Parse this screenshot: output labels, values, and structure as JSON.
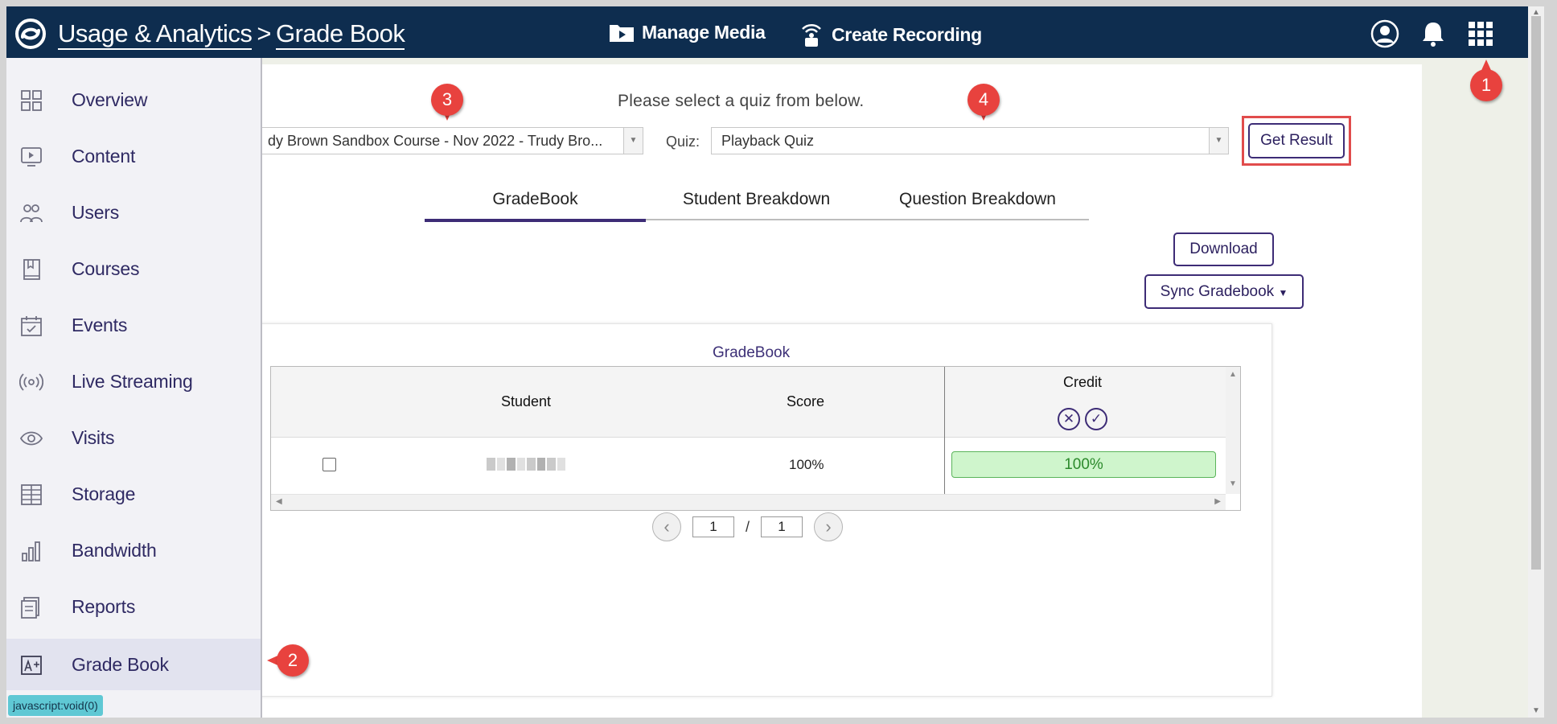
{
  "header": {
    "breadcrumb_parent": "Usage & Analytics",
    "breadcrumb_sep": ">",
    "breadcrumb_current": "Grade Book",
    "manage_media": "Manage Media",
    "create_recording": "Create Recording"
  },
  "sidebar": {
    "items": [
      {
        "label": "Overview",
        "icon": "grid-icon"
      },
      {
        "label": "Content",
        "icon": "play-screen-icon"
      },
      {
        "label": "Users",
        "icon": "users-icon"
      },
      {
        "label": "Courses",
        "icon": "book-icon"
      },
      {
        "label": "Events",
        "icon": "calendar-check-icon"
      },
      {
        "label": "Live Streaming",
        "icon": "broadcast-icon"
      },
      {
        "label": "Visits",
        "icon": "eye-icon"
      },
      {
        "label": "Storage",
        "icon": "storage-icon"
      },
      {
        "label": "Bandwidth",
        "icon": "bar-chart-icon"
      },
      {
        "label": "Reports",
        "icon": "reports-icon"
      },
      {
        "label": "Grade Book",
        "icon": "grade-icon",
        "active": true
      }
    ]
  },
  "filters": {
    "prompt": "Please select a quiz from below.",
    "course_value": "dy Brown Sandbox Course - Nov 2022 - Trudy Bro...",
    "quiz_label": "Quiz:",
    "quiz_value": "Playback Quiz",
    "get_result": "Get Result"
  },
  "tabs": [
    {
      "label": "GradeBook",
      "active": true
    },
    {
      "label": "Student Breakdown"
    },
    {
      "label": "Question Breakdown"
    }
  ],
  "actions": {
    "download": "Download",
    "sync": "Sync Gradebook"
  },
  "gradebook": {
    "title": "GradeBook",
    "columns": {
      "student": "Student",
      "score": "Score",
      "credit": "Credit"
    },
    "rows": [
      {
        "student": "",
        "score": "100%",
        "credit": "100%"
      }
    ]
  },
  "pager": {
    "current": "1",
    "sep": "/",
    "total": "1"
  },
  "status_bar": "javascript:void(0)",
  "callouts": [
    "1",
    "2",
    "3",
    "4"
  ],
  "colors": {
    "topbar": "#0e2d4f",
    "accent": "#3d2c76",
    "callout": "#e8423e",
    "credit_fill": "#cff5cc",
    "highlight": "#e14c4c"
  }
}
